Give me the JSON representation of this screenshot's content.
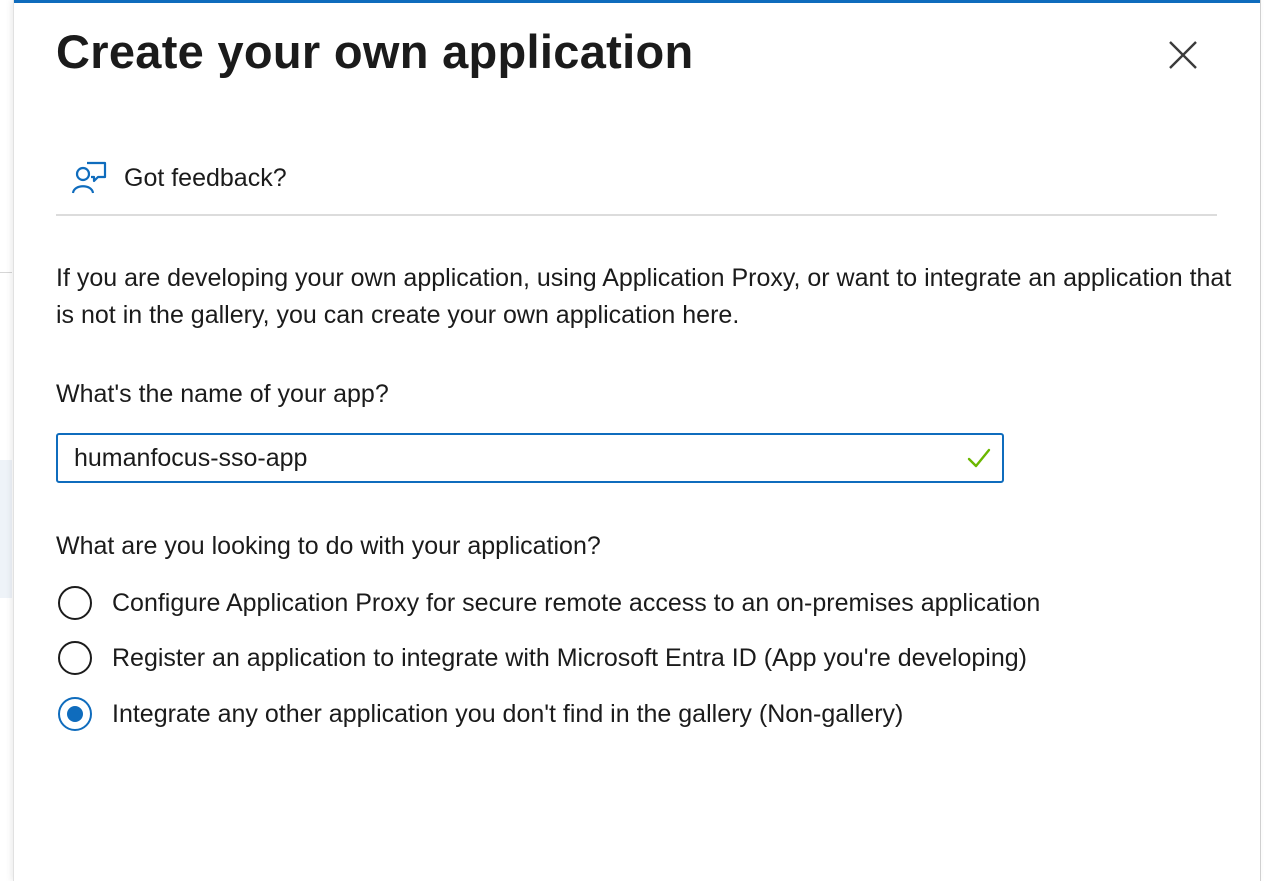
{
  "panel": {
    "title": "Create your own application",
    "close_icon": "close-icon"
  },
  "feedback": {
    "icon": "feedback-person-icon",
    "label": "Got feedback?"
  },
  "intro_text": "If you are developing your own application, using Application Proxy, or want to integrate an application that is not in the gallery, you can create your own application here.",
  "app_name": {
    "label": "What's the name of your app?",
    "value": "humanfocus-sso-app",
    "validation_icon": "checkmark-icon",
    "valid": true
  },
  "purpose": {
    "label": "What are you looking to do with your application?",
    "options": [
      {
        "label": "Configure Application Proxy for secure remote access to an on-premises application",
        "selected": false
      },
      {
        "label": "Register an application to integrate with Microsoft Entra ID (App you're developing)",
        "selected": false
      },
      {
        "label": "Integrate any other application you don't find in the gallery (Non-gallery)",
        "selected": true
      }
    ]
  },
  "colors": {
    "accent": "#0f6cbd",
    "success": "#6bb700",
    "text": "#1b1b1b",
    "divider": "#dcdcdc"
  }
}
